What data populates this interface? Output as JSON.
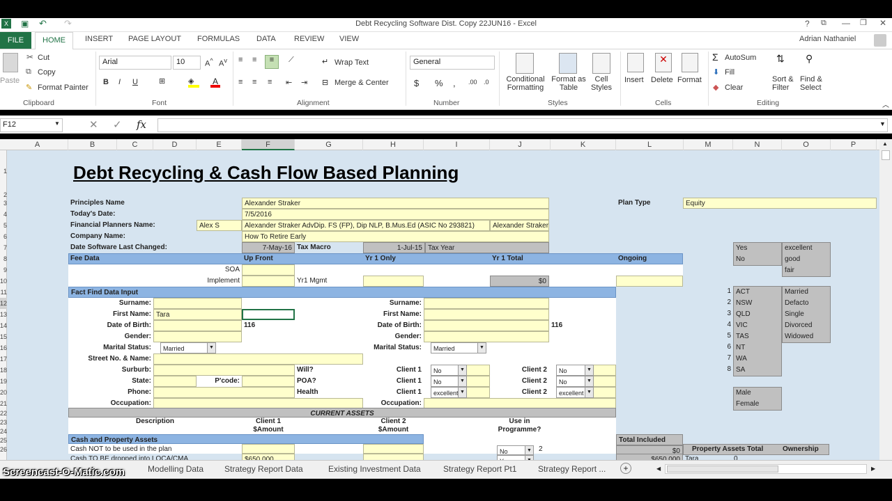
{
  "window": {
    "title": "Debt Recycling Software Dist. Copy 22JUN16 - Excel",
    "user": "Adrian Nathaniel"
  },
  "tabs": [
    "FILE",
    "HOME",
    "INSERT",
    "PAGE LAYOUT",
    "FORMULAS",
    "DATA",
    "REVIEW",
    "VIEW"
  ],
  "ribbon": {
    "paste": "Paste",
    "cut": "Cut",
    "copy": "Copy",
    "format_painter": "Format Painter",
    "clipboard": "Clipboard",
    "font_name": "Arial",
    "font_size": "10",
    "font": "Font",
    "wrap_text": "Wrap Text",
    "merge_center": "Merge & Center",
    "alignment": "Alignment",
    "number_format": "General",
    "number": "Number",
    "conditional": "Conditional",
    "formatting": "Formatting",
    "format_as": "Format as",
    "table": "Table",
    "cell": "Cell",
    "styles_btn": "Styles",
    "styles": "Styles",
    "insert": "Insert",
    "delete": "Delete",
    "format": "Format",
    "cells": "Cells",
    "autosum": "AutoSum",
    "fill": "Fill",
    "clear": "Clear",
    "sort": "Sort &",
    "filter": "Filter",
    "find": "Find &",
    "select": "Select",
    "editing": "Editing"
  },
  "namebox": "F12",
  "fx": "fx",
  "columns": [
    "A",
    "B",
    "C",
    "D",
    "E",
    "F",
    "G",
    "H",
    "I",
    "J",
    "K",
    "L",
    "M",
    "N",
    "O",
    "P"
  ],
  "rows": [
    "1",
    "2",
    "3",
    "4",
    "5",
    "6",
    "7",
    "8",
    "9",
    "10",
    "11",
    "12",
    "13",
    "14",
    "15",
    "16",
    "17",
    "18",
    "19",
    "20",
    "21",
    "22",
    "23",
    "24",
    "25",
    "26"
  ],
  "sheet": {
    "title": "Debt Recycling & Cash Flow Based Planning",
    "principles_label": "Principles Name",
    "principles": "Alexander Straker",
    "date_label": "Today's Date:",
    "date": "7/5/2016",
    "fp_label": "Financial Planners Name:",
    "fp_short": "Alex S",
    "fp": "Alexander Straker AdvDip. FS (FP), Dip NLP, B.Mus.Ed (ASIC No 293821)",
    "fp2": "Alexander Straker",
    "company_label": "Company Name:",
    "company": "How To Retire Early",
    "changed_label": "Date Software Last Changed:",
    "changed": "7-May-16",
    "tax_macro": "Tax Macro",
    "tax_year_date": "1-Jul-15",
    "tax_year": "Tax Year",
    "plan_type_label": "Plan Type",
    "plan_type": "Equity",
    "fee_data": "Fee Data",
    "up_front": "Up Front",
    "yr1_only": "Yr 1 Only",
    "yr1_total": "Yr 1 Total",
    "ongoing": "Ongoing",
    "soa": "SOA",
    "implement": "Implement",
    "yr1_mgmt": "Yr1 Mgmt",
    "zero": "$0",
    "fact_find": "Fact Find Data Input",
    "surname": "Surname:",
    "first_name": "First Name:",
    "first_name_val": "Tara",
    "dob": "Date of Birth:",
    "age1": "116",
    "age2": "116",
    "gender": "Gender:",
    "marital": "Marital Status:",
    "married": "Married",
    "one": "1",
    "street": "Street No. & Name:",
    "suburb": "Surburb:",
    "state": "State:",
    "pcode": "P'code:",
    "will": "Will?",
    "poa": "POA?",
    "health": "Health",
    "client1": "Client 1",
    "client2": "Client 2",
    "no": "No",
    "excellent": "excellent",
    "phone": "Phone:",
    "occupation": "Occupation:",
    "current_assets": "CURRENT ASSETS",
    "description": "Description",
    "client1_amt": "Client 1",
    "client2_amt": "Client 2",
    "amount": "$Amount",
    "use_in": "Use in",
    "programme": "Programme?",
    "cash_prop": "Cash and Property Assets",
    "cash_not": "Cash NOT to be used in the plan",
    "cash_tbd": "Cash TO BE dropped into LOCA/CMA",
    "cash_val": "$650,000",
    "two": "2",
    "yes": "Yes",
    "total_included": "Total Included",
    "total_val": "$0",
    "total_650": "$650,000",
    "prop_total": "Property Assets Total",
    "ownership": "Ownership",
    "tara": "Tara",
    "prop_zero": "0",
    "lists": {
      "yesno": [
        "Yes",
        "No"
      ],
      "quality": [
        "excellent",
        "good",
        "fair"
      ],
      "nums": [
        "1",
        "2",
        "3",
        "4",
        "5",
        "6",
        "7",
        "8"
      ],
      "states": [
        "ACT",
        "NSW",
        "QLD",
        "VIC",
        "TAS",
        "NT",
        "WA",
        "SA"
      ],
      "marital": [
        "Married",
        "Defacto",
        "Single",
        "Divorced",
        "Widowed"
      ],
      "gender": [
        "Male",
        "Female"
      ]
    }
  },
  "sheet_tabs": [
    "Modelling Data",
    "Strategy Report Data",
    "Existing Investment Data",
    "Strategy Report Pt1",
    "Strategy Report ..."
  ],
  "watermark": "Screencast-O-Matic.com"
}
